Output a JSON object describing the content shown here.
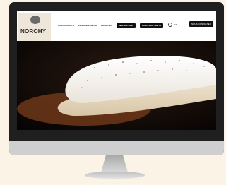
{
  "brand": {
    "name": "NOROHY"
  },
  "nav": {
    "items": [
      "NOS PRODUITS",
      "LE MONDE DE NO",
      "RECETTES",
      "INSPIRATIONS",
      "POINTS DE VENTE"
    ],
    "highlighted_index": 3
  },
  "tools": {
    "lang": "FR"
  },
  "cta": {
    "label": "NOUS CONTACTER"
  },
  "hero": {
    "image": "vanilla-eclair-photo"
  },
  "colors": {
    "background": "#fbf4e6",
    "monitor": "#1f1f1f",
    "chin": "#cfcfcf",
    "accent_dark": "#111111"
  }
}
